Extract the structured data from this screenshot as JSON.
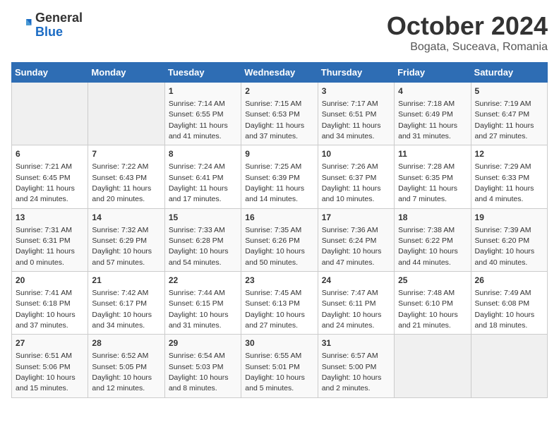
{
  "header": {
    "logo_general": "General",
    "logo_blue": "Blue",
    "title": "October 2024",
    "location": "Bogata, Suceava, Romania"
  },
  "weekdays": [
    "Sunday",
    "Monday",
    "Tuesday",
    "Wednesday",
    "Thursday",
    "Friday",
    "Saturday"
  ],
  "weeks": [
    [
      {
        "day": "",
        "empty": true
      },
      {
        "day": "",
        "empty": true
      },
      {
        "day": "1",
        "sunrise": "7:14 AM",
        "sunset": "6:55 PM",
        "daylight": "11 hours and 41 minutes."
      },
      {
        "day": "2",
        "sunrise": "7:15 AM",
        "sunset": "6:53 PM",
        "daylight": "11 hours and 37 minutes."
      },
      {
        "day": "3",
        "sunrise": "7:17 AM",
        "sunset": "6:51 PM",
        "daylight": "11 hours and 34 minutes."
      },
      {
        "day": "4",
        "sunrise": "7:18 AM",
        "sunset": "6:49 PM",
        "daylight": "11 hours and 31 minutes."
      },
      {
        "day": "5",
        "sunrise": "7:19 AM",
        "sunset": "6:47 PM",
        "daylight": "11 hours and 27 minutes."
      }
    ],
    [
      {
        "day": "6",
        "sunrise": "7:21 AM",
        "sunset": "6:45 PM",
        "daylight": "11 hours and 24 minutes."
      },
      {
        "day": "7",
        "sunrise": "7:22 AM",
        "sunset": "6:43 PM",
        "daylight": "11 hours and 20 minutes."
      },
      {
        "day": "8",
        "sunrise": "7:24 AM",
        "sunset": "6:41 PM",
        "daylight": "11 hours and 17 minutes."
      },
      {
        "day": "9",
        "sunrise": "7:25 AM",
        "sunset": "6:39 PM",
        "daylight": "11 hours and 14 minutes."
      },
      {
        "day": "10",
        "sunrise": "7:26 AM",
        "sunset": "6:37 PM",
        "daylight": "11 hours and 10 minutes."
      },
      {
        "day": "11",
        "sunrise": "7:28 AM",
        "sunset": "6:35 PM",
        "daylight": "11 hours and 7 minutes."
      },
      {
        "day": "12",
        "sunrise": "7:29 AM",
        "sunset": "6:33 PM",
        "daylight": "11 hours and 4 minutes."
      }
    ],
    [
      {
        "day": "13",
        "sunrise": "7:31 AM",
        "sunset": "6:31 PM",
        "daylight": "11 hours and 0 minutes."
      },
      {
        "day": "14",
        "sunrise": "7:32 AM",
        "sunset": "6:29 PM",
        "daylight": "10 hours and 57 minutes."
      },
      {
        "day": "15",
        "sunrise": "7:33 AM",
        "sunset": "6:28 PM",
        "daylight": "10 hours and 54 minutes."
      },
      {
        "day": "16",
        "sunrise": "7:35 AM",
        "sunset": "6:26 PM",
        "daylight": "10 hours and 50 minutes."
      },
      {
        "day": "17",
        "sunrise": "7:36 AM",
        "sunset": "6:24 PM",
        "daylight": "10 hours and 47 minutes."
      },
      {
        "day": "18",
        "sunrise": "7:38 AM",
        "sunset": "6:22 PM",
        "daylight": "10 hours and 44 minutes."
      },
      {
        "day": "19",
        "sunrise": "7:39 AM",
        "sunset": "6:20 PM",
        "daylight": "10 hours and 40 minutes."
      }
    ],
    [
      {
        "day": "20",
        "sunrise": "7:41 AM",
        "sunset": "6:18 PM",
        "daylight": "10 hours and 37 minutes."
      },
      {
        "day": "21",
        "sunrise": "7:42 AM",
        "sunset": "6:17 PM",
        "daylight": "10 hours and 34 minutes."
      },
      {
        "day": "22",
        "sunrise": "7:44 AM",
        "sunset": "6:15 PM",
        "daylight": "10 hours and 31 minutes."
      },
      {
        "day": "23",
        "sunrise": "7:45 AM",
        "sunset": "6:13 PM",
        "daylight": "10 hours and 27 minutes."
      },
      {
        "day": "24",
        "sunrise": "7:47 AM",
        "sunset": "6:11 PM",
        "daylight": "10 hours and 24 minutes."
      },
      {
        "day": "25",
        "sunrise": "7:48 AM",
        "sunset": "6:10 PM",
        "daylight": "10 hours and 21 minutes."
      },
      {
        "day": "26",
        "sunrise": "7:49 AM",
        "sunset": "6:08 PM",
        "daylight": "10 hours and 18 minutes."
      }
    ],
    [
      {
        "day": "27",
        "sunrise": "6:51 AM",
        "sunset": "5:06 PM",
        "daylight": "10 hours and 15 minutes."
      },
      {
        "day": "28",
        "sunrise": "6:52 AM",
        "sunset": "5:05 PM",
        "daylight": "10 hours and 12 minutes."
      },
      {
        "day": "29",
        "sunrise": "6:54 AM",
        "sunset": "5:03 PM",
        "daylight": "10 hours and 8 minutes."
      },
      {
        "day": "30",
        "sunrise": "6:55 AM",
        "sunset": "5:01 PM",
        "daylight": "10 hours and 5 minutes."
      },
      {
        "day": "31",
        "sunrise": "6:57 AM",
        "sunset": "5:00 PM",
        "daylight": "10 hours and 2 minutes."
      },
      {
        "day": "",
        "empty": true
      },
      {
        "day": "",
        "empty": true
      }
    ]
  ]
}
